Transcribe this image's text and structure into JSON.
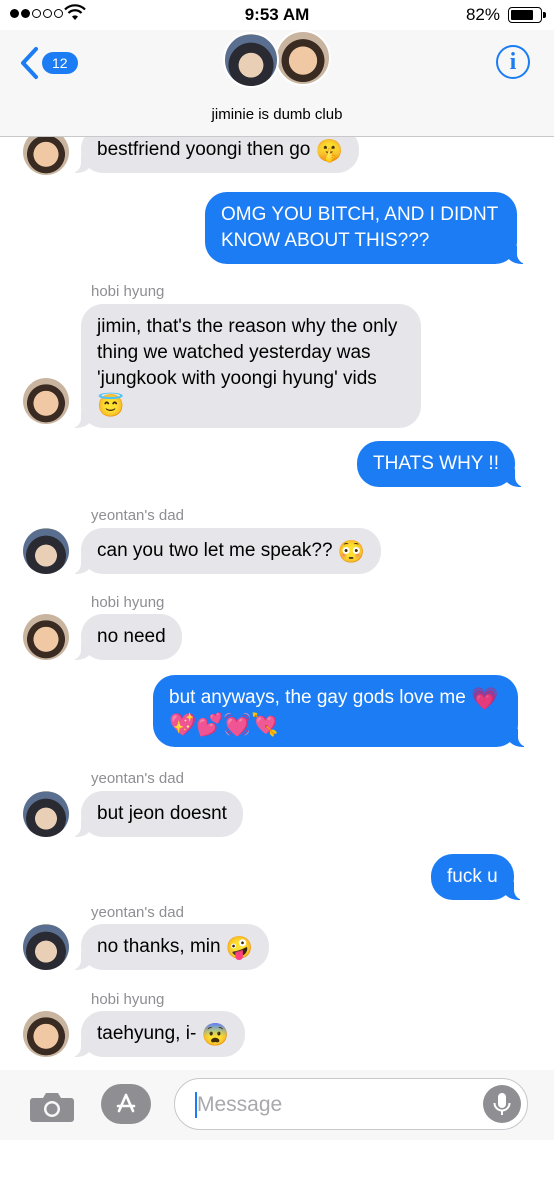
{
  "status_bar": {
    "time": "9:53 AM",
    "battery_percent": "82%",
    "battery_level": 0.82,
    "signal_bars_filled": 2,
    "signal_bars_total": 5
  },
  "header": {
    "back_badge": "12",
    "group_name": "jiminie is dumb club",
    "info_label": "i"
  },
  "messages": [
    {
      "text": "bestfriend yoongi then go",
      "emoji": "🤫"
    },
    {
      "text": "OMG YOU BITCH, AND I DIDNT KNOW ABOUT THIS???"
    },
    {
      "sender": "hobi hyung",
      "text": "jimin, that's the reason why the only thing we watched yesterday was 'jungkook with yoongi hyung' vids",
      "emoji": "😇"
    },
    {
      "text": "THATS WHY !!"
    },
    {
      "sender": "yeontan's dad",
      "text": "can you two let me speak??",
      "emoji": "😳"
    },
    {
      "sender": "hobi hyung",
      "text": "no need"
    },
    {
      "text": "but anyways, the gay gods love me",
      "emoji": "💗",
      "emoji_line": "💖💕💓💘"
    },
    {
      "sender": "yeontan's dad",
      "text": "but jeon doesnt"
    },
    {
      "text": "fuck u"
    },
    {
      "sender": "yeontan's dad",
      "text": "no thanks, min",
      "emoji": "🤪"
    },
    {
      "sender": "hobi hyung",
      "text": "taehyung, i-",
      "emoji": "😨"
    }
  ],
  "input": {
    "placeholder": "Message",
    "value": ""
  },
  "colors": {
    "accent": "#1c7cf4",
    "incoming_bubble": "#e5e5ea",
    "outgoing_bubble": "#1c7cf4"
  },
  "icons": [
    "signal-icon",
    "wifi-icon",
    "battery-icon",
    "chevron-left-icon",
    "info-icon",
    "camera-icon",
    "app-store-icon",
    "microphone-icon"
  ]
}
